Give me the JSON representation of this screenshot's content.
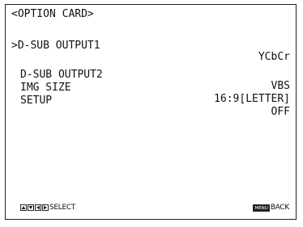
{
  "menu": {
    "title": "<OPTION CARD>",
    "cursor": ">",
    "items": [
      {
        "label": "D-SUB OUTPUT1",
        "value": "YCbCr",
        "selected": true
      },
      {
        "label": "D-SUB OUTPUT2",
        "value": "VBS",
        "selected": false
      },
      {
        "label": "IMG SIZE",
        "value": "16:9[LETTER]",
        "selected": false
      },
      {
        "label": "SETUP",
        "value": "OFF",
        "selected": false
      }
    ]
  },
  "footer": {
    "select_label": "SELECT",
    "back_label": "BACK",
    "menu_key_label": "MENU",
    "select_keys": [
      "up-arrow-icon",
      "down-arrow-icon",
      "left-arrow-icon",
      "right-arrow-icon"
    ]
  }
}
